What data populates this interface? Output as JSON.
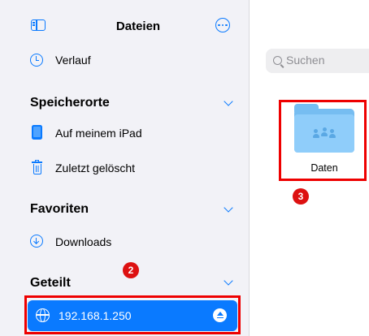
{
  "header": {
    "title": "Dateien"
  },
  "sidebar": {
    "recents_label": "Verlauf",
    "sections": {
      "locations": "Speicherorte",
      "favorites": "Favoriten",
      "shared": "Geteilt"
    },
    "locations_items": [
      "Auf meinem iPad",
      "Zuletzt gelöscht"
    ],
    "favorites_items": [
      "Downloads"
    ],
    "shared_items": [
      "192.168.1.250"
    ]
  },
  "search": {
    "placeholder": "Suchen"
  },
  "content": {
    "folder_name": "Daten"
  },
  "annotations": {
    "step2": "2",
    "step3": "3"
  },
  "colors": {
    "accent": "#0a7aff",
    "highlight": "#ee0000",
    "sidebar_bg": "#f2f2f7"
  }
}
